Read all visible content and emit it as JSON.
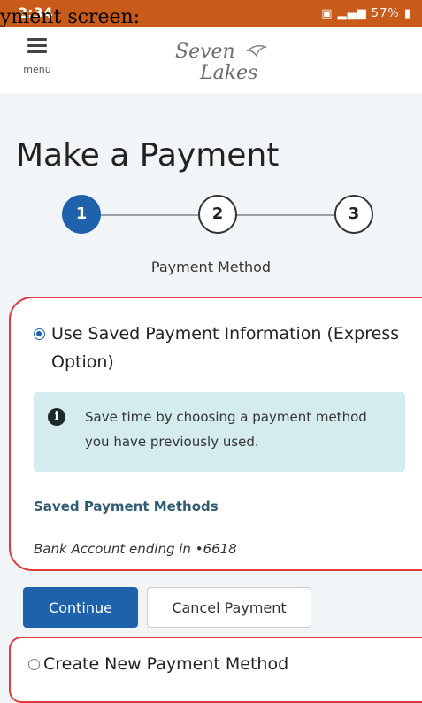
{
  "overlay_caption": "yment screen:",
  "status_bar": {
    "time": "2:34",
    "battery": "57%"
  },
  "header": {
    "menu_label": "menu",
    "logo_line1": "Seven",
    "logo_line2": "Lakes"
  },
  "page": {
    "title": "Make a Payment",
    "steps": [
      "1",
      "2",
      "3"
    ],
    "active_step": 1,
    "step_label": "Payment Method"
  },
  "saved_option": {
    "label": "Use Saved Payment Information (Express Option)",
    "selected": true,
    "info_text": "Save time by choosing a payment method you have previously used.",
    "saved_methods_heading": "Saved Payment Methods",
    "saved_method": "Bank Account ending in •6618"
  },
  "buttons": {
    "continue": "Continue",
    "cancel": "Cancel Payment"
  },
  "new_option": {
    "label": "Create New Payment Method",
    "selected": false
  },
  "colors": {
    "status_bar": "#c85a1a",
    "primary": "#1d62aa",
    "info_bg": "#d5ecee",
    "highlight_outline": "#e23a3a"
  }
}
